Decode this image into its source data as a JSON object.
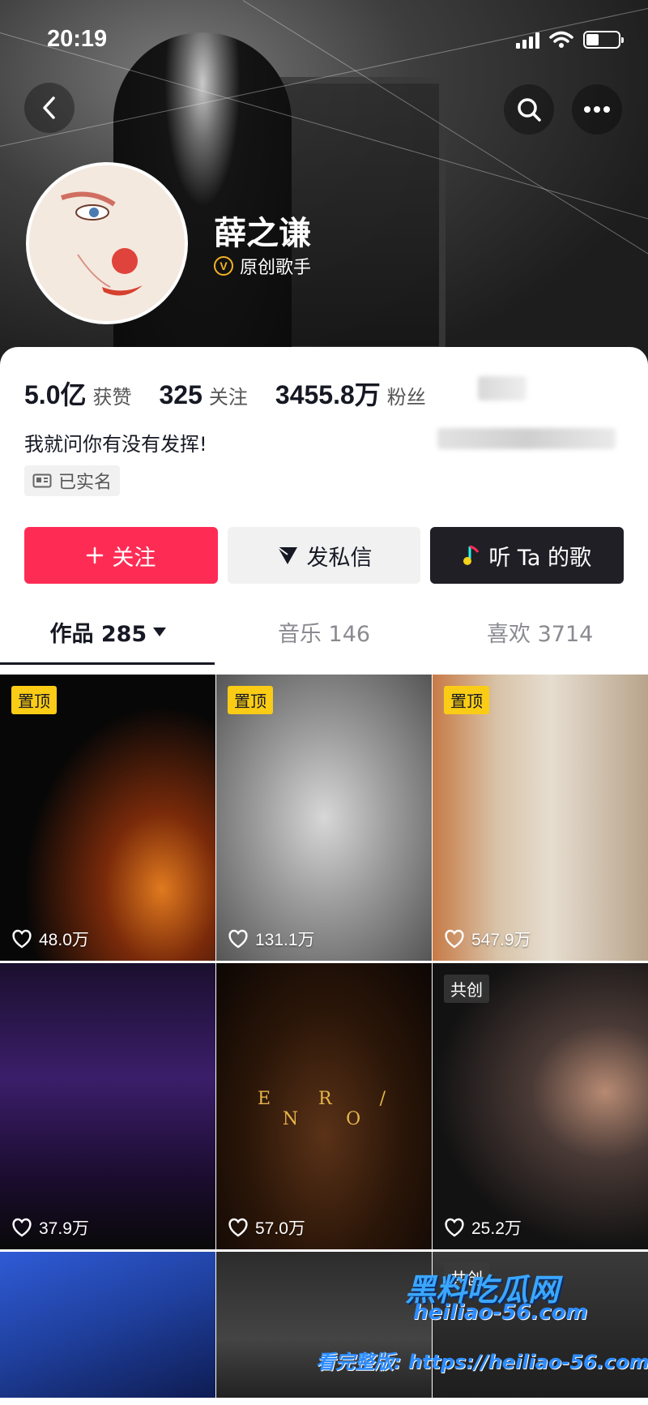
{
  "status_bar": {
    "time": "20:19"
  },
  "profile": {
    "nickname": "薛之谦",
    "verify_badge": "V",
    "verify_label": "原创歌手",
    "bio": "我就问你有没有发挥!",
    "realname_tag": "已实名"
  },
  "stats": {
    "likes_num": "5.0亿",
    "likes_label": "获赞",
    "following_num": "325",
    "following_label": "关注",
    "fans_num": "3455.8万",
    "fans_label": "粉丝"
  },
  "actions": {
    "follow_label": "关注",
    "message_label": "发私信",
    "music_label": "听 Ta 的歌"
  },
  "tabs": {
    "works": "作品 285",
    "music": "音乐 146",
    "likes": "喜欢 3714"
  },
  "videos": [
    {
      "badge": "置顶",
      "likes": "48.0万"
    },
    {
      "badge": "置顶",
      "likes": "131.1万"
    },
    {
      "badge": "置顶",
      "likes": "547.9万"
    },
    {
      "badge": "",
      "likes": "37.9万"
    },
    {
      "badge": "",
      "likes": "57.0万",
      "overlay": "E R / N O"
    },
    {
      "badge": "共创",
      "likes": "25.2万"
    },
    {
      "badge": "",
      "likes": ""
    },
    {
      "badge": "",
      "likes": ""
    },
    {
      "badge": "共创",
      "likes": ""
    }
  ],
  "watermark": {
    "title": "黑料吃瓜网",
    "url_line": "heiliao-56.com",
    "url_prefix": "看完整版: https://heiliao-56.com"
  },
  "colors": {
    "accent_red": "#fe2c55",
    "pin_badge": "#facc15",
    "verify_gold": "#f4b321"
  },
  "icons": [
    "back-icon",
    "search-icon",
    "more-icon",
    "heart-icon",
    "plus-icon",
    "send-icon",
    "music-note-icon",
    "id-card-icon",
    "signal-icon",
    "wifi-icon",
    "battery-icon"
  ]
}
